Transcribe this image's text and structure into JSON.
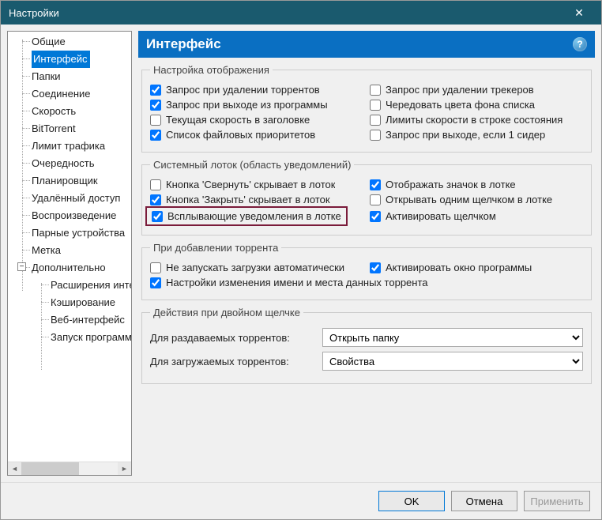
{
  "window": {
    "title": "Настройки"
  },
  "sidebar": {
    "items": [
      {
        "label": "Общие"
      },
      {
        "label": "Интерфейс",
        "selected": true
      },
      {
        "label": "Папки"
      },
      {
        "label": "Соединение"
      },
      {
        "label": "Скорость"
      },
      {
        "label": "BitTorrent"
      },
      {
        "label": "Лимит трафика"
      },
      {
        "label": "Очередность"
      },
      {
        "label": "Планировщик"
      },
      {
        "label": "Удалённый доступ"
      },
      {
        "label": "Воспроизведение"
      },
      {
        "label": "Парные устройства"
      },
      {
        "label": "Метка"
      },
      {
        "label": "Дополнительно",
        "children": [
          {
            "label": "Расширения интерфейса"
          },
          {
            "label": "Кэширование"
          },
          {
            "label": "Веб-интерфейс"
          },
          {
            "label": "Запуск программ"
          }
        ]
      }
    ],
    "expander": "−"
  },
  "panel": {
    "title": "Интерфейс"
  },
  "groups": {
    "display": {
      "legend": "Настройка отображения",
      "left": [
        {
          "label": "Запрос при удалении торрентов",
          "checked": true
        },
        {
          "label": "Запрос при выходе из программы",
          "checked": true
        },
        {
          "label": "Текущая скорость в заголовке",
          "checked": false
        },
        {
          "label": "Список файловых приоритетов",
          "checked": true
        }
      ],
      "right": [
        {
          "label": "Запрос при удалении трекеров",
          "checked": false
        },
        {
          "label": "Чередовать цвета фона списка",
          "checked": false
        },
        {
          "label": "Лимиты скорости в строке состояния",
          "checked": false
        },
        {
          "label": "Запрос при выходе, если 1 сидер",
          "checked": false
        }
      ]
    },
    "tray": {
      "legend": "Системный лоток (область уведомлений)",
      "left": [
        {
          "label": "Кнопка 'Свернуть' скрывает в лоток",
          "checked": false
        },
        {
          "label": "Кнопка 'Закрыть' скрывает в лоток",
          "checked": true
        },
        {
          "label": "Всплывающие уведомления в лотке",
          "checked": true,
          "highlight": true
        }
      ],
      "right": [
        {
          "label": "Отображать значок в лотке",
          "checked": true
        },
        {
          "label": "Открывать одним щелчком в лотке",
          "checked": false
        },
        {
          "label": "Активировать щелчком",
          "checked": true
        }
      ]
    },
    "add": {
      "legend": "При добавлении торрента",
      "rows": [
        {
          "left": {
            "label": "Не запускать загрузки автоматически",
            "checked": false
          },
          "right": {
            "label": "Активировать окно программы",
            "checked": true
          }
        },
        {
          "full": {
            "label": "Настройки изменения имени и места данных торрента",
            "checked": true
          }
        }
      ]
    },
    "dblclick": {
      "legend": "Действия при двойном щелчке",
      "seeding_label": "Для раздаваемых торрентов:",
      "seeding_value": "Открыть папку",
      "downloading_label": "Для загружаемых торрентов:",
      "downloading_value": "Свойства"
    }
  },
  "buttons": {
    "ok": "OK",
    "cancel": "Отмена",
    "apply": "Применить"
  }
}
